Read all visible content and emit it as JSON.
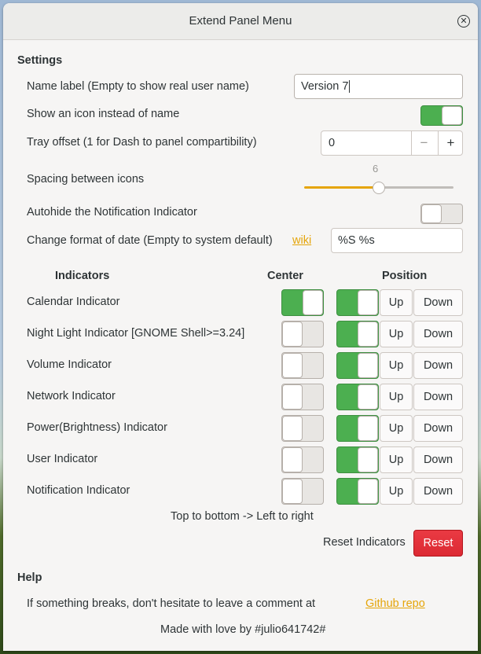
{
  "window": {
    "title": "Extend Panel Menu"
  },
  "settings": {
    "heading": "Settings",
    "name_label": {
      "label": "Name label (Empty to show real user name)",
      "value": "Version 7"
    },
    "show_icon": {
      "label": "Show an icon instead of name",
      "state": "on"
    },
    "tray_offset": {
      "label": "Tray offset (1 for Dash to panel compartibility)",
      "value": "0",
      "minus": "−",
      "plus": "+"
    },
    "spacing": {
      "label": "Spacing between icons",
      "value": "6",
      "fraction": 0.5,
      "accent": "#e5a50a"
    },
    "autohide": {
      "label": "Autohide the Notification Indicator",
      "state": "off"
    },
    "date_format": {
      "label": "Change format of date (Empty to system default)",
      "link": "wiki",
      "value": "%S %s"
    }
  },
  "indicators": {
    "header": {
      "name": "Indicators",
      "center": "Center",
      "position": "Position"
    },
    "up_label": "Up",
    "down_label": "Down",
    "rows": [
      {
        "label": "Calendar Indicator",
        "center": "on",
        "enabled": "on"
      },
      {
        "label": "Night Light Indicator [GNOME Shell>=3.24]",
        "center": "off",
        "enabled": "on"
      },
      {
        "label": "Volume Indicator",
        "center": "off",
        "enabled": "on"
      },
      {
        "label": "Network Indicator",
        "center": "off",
        "enabled": "on"
      },
      {
        "label": "Power(Brightness) Indicator",
        "center": "off",
        "enabled": "on"
      },
      {
        "label": "User Indicator",
        "center": "off",
        "enabled": "on"
      },
      {
        "label": "Notification Indicator",
        "center": "off",
        "enabled": "on"
      }
    ],
    "order_note": "Top to bottom -> Left to right",
    "reset_label": "Reset Indicators",
    "reset_button": "Reset"
  },
  "help": {
    "heading": "Help",
    "text": "If something breaks, don't hesitate to leave a comment at",
    "link": "Github repo",
    "footer": "Made with love by #julio641742#"
  },
  "colors": {
    "switch_on": "#4caf50",
    "destructive": "#e01b24",
    "link": "#e5a50a"
  }
}
